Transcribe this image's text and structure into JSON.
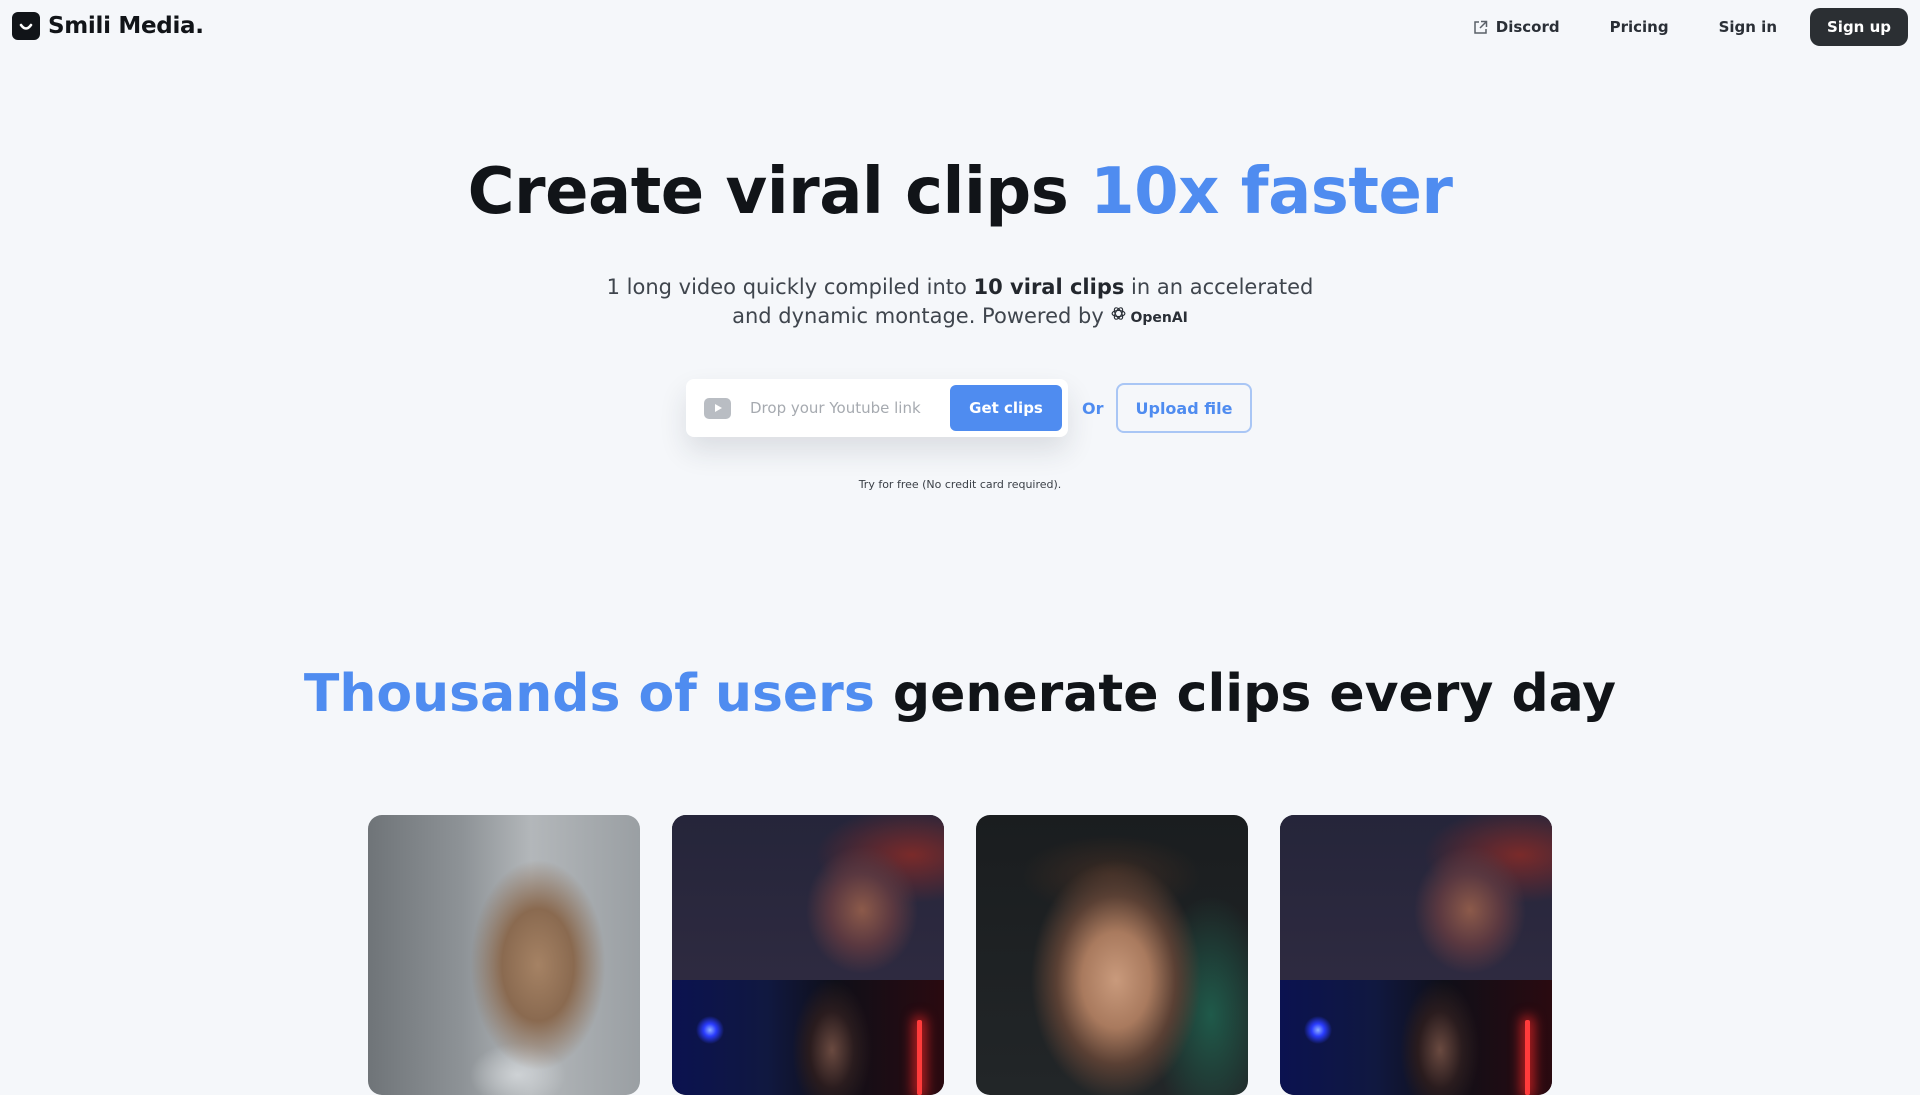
{
  "nav": {
    "brand": "Smili Media.",
    "discord_label": "Discord",
    "pricing_label": "Pricing",
    "signin_label": "Sign in",
    "signup_label": "Sign up"
  },
  "hero": {
    "title_main": "Create viral clips ",
    "title_accent": "10x faster",
    "subtitle_part1": "1 long video quickly compiled into ",
    "subtitle_bold": "10 viral clips",
    "subtitle_part2": " in an accelerated",
    "subtitle_line2": "and dynamic montage. Powered by ",
    "powered_by": "OpenAI",
    "input_placeholder": "Drop your Youtube link",
    "get_clips_label": "Get clips",
    "or_label": "Or",
    "upload_label": "Upload file",
    "note": "Try for free (No credit card required)."
  },
  "section": {
    "title_accent": "Thousands of users",
    "title_main": " generate clips every day"
  },
  "colors": {
    "accent": "#4f8cf0",
    "dark_button": "#2b2f33",
    "background": "#f5f7fa"
  }
}
